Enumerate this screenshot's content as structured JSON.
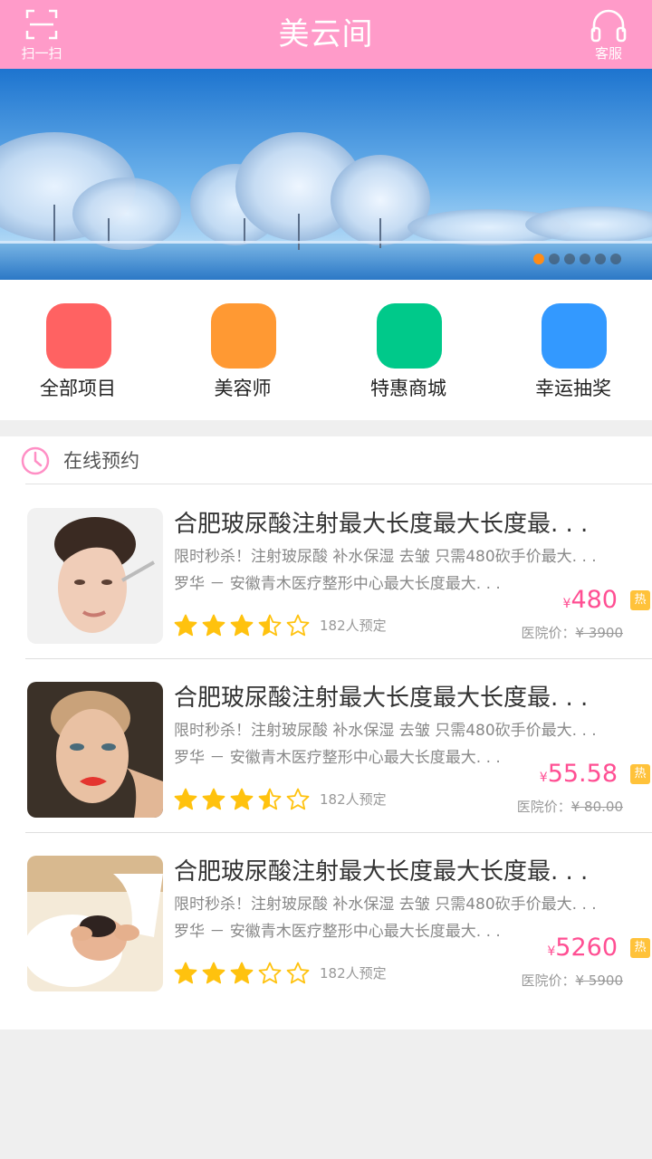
{
  "header": {
    "title": "美云间",
    "scan_label": "扫一扫",
    "service_label": "客服",
    "bg_color": "#ff9bc9"
  },
  "banner": {
    "slide_count": 6,
    "active_index": 0
  },
  "quick_menu": [
    {
      "label": "全部项目",
      "color": "#ff6262"
    },
    {
      "label": "美容师",
      "color": "#ff9933"
    },
    {
      "label": "特惠商城",
      "color": "#00c98a"
    },
    {
      "label": "幸运抽奖",
      "color": "#3399ff"
    }
  ],
  "section": {
    "title": "在线预约",
    "icon": "clock-icon"
  },
  "items": [
    {
      "title": "合肥玻尿酸注射最大长度最大长度最. . .",
      "desc": "限时秒杀！注射玻尿酸  补水保湿  去皱  只需480砍手价最大. . .",
      "location": "罗华 － 安徽青木医疗整形中心最大长度最大. . .",
      "rating": 3.5,
      "booked": "182人预定",
      "currency": "¥",
      "price": "480",
      "hot": "热",
      "orig_label": "医院价：",
      "orig_price": "¥ 3900"
    },
    {
      "title": "合肥玻尿酸注射最大长度最大长度最. . .",
      "desc": "限时秒杀！注射玻尿酸  补水保湿  去皱  只需480砍手价最大. . .",
      "location": "罗华 － 安徽青木医疗整形中心最大长度最大. . .",
      "rating": 3.5,
      "booked": "182人预定",
      "currency": "¥",
      "price": "55.58",
      "hot": "热",
      "orig_label": "医院价：",
      "orig_price": "¥ 80.00"
    },
    {
      "title": "合肥玻尿酸注射最大长度最大长度最. . .",
      "desc": "限时秒杀！注射玻尿酸  补水保湿  去皱  只需480砍手价最大. . .",
      "location": "罗华 － 安徽青木医疗整形中心最大长度最大. . .",
      "rating": 3,
      "booked": "182人预定",
      "currency": "¥",
      "price": "5260",
      "hot": "热",
      "orig_label": "医院价：",
      "orig_price": "¥ 5900"
    }
  ]
}
